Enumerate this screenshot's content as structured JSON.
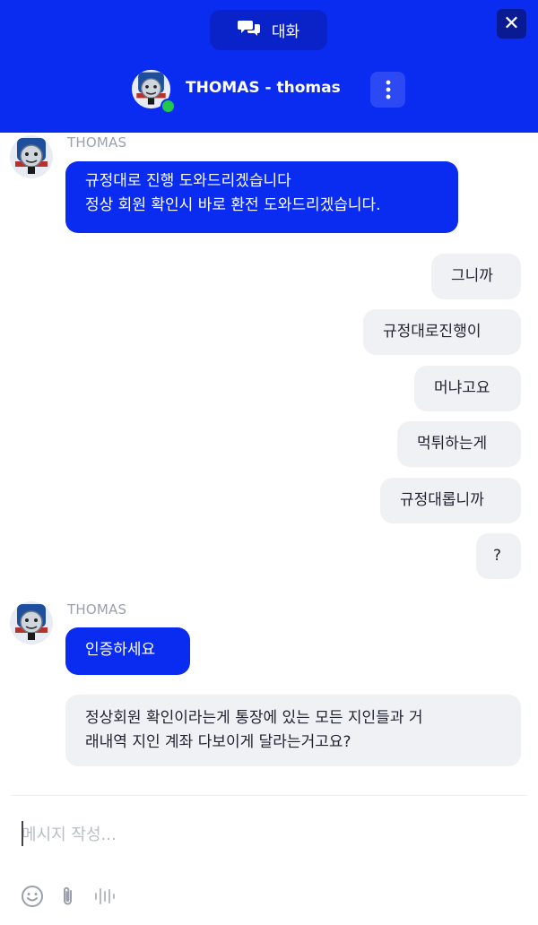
{
  "header": {
    "tab_label": "대화",
    "close_label": "✕",
    "agent_title": "THOMAS - thomas"
  },
  "messages": {
    "group1_sender": "THOMAS",
    "group1_bubble1_line1": "규정대로 진행 도와드리겠습니다",
    "group1_bubble1_line2": "정상 회원 확인시 바로 환전 도와드리겠습니다.",
    "user1": "그니까",
    "user2": "규정대로진행이",
    "user3": "머냐고요",
    "user4": "먹튀하는게",
    "user5": "규정대롭니까",
    "user6": "?",
    "group2_sender": "THOMAS",
    "group2_bubble1": "인증하세요",
    "group2_bubble2_line1": "정상회원 확인이라는게 통장에 있는 모든 지인들과 거",
    "group2_bubble2_line2": "래내역 지인 계좌 다보이게 달라는거고요?"
  },
  "composer": {
    "placeholder": "메시지 작성..."
  },
  "icons": {
    "tab": "chat-bubbles-icon",
    "close": "close-icon",
    "menu": "kebab-menu-icon",
    "emoji": "smiley-icon",
    "attach": "paperclip-icon",
    "voice": "voice-wave-icon"
  },
  "colors": {
    "brand_blue": "#0a2bf0",
    "online_green": "#20c94a",
    "bubble_gray": "#f0f1f4"
  }
}
